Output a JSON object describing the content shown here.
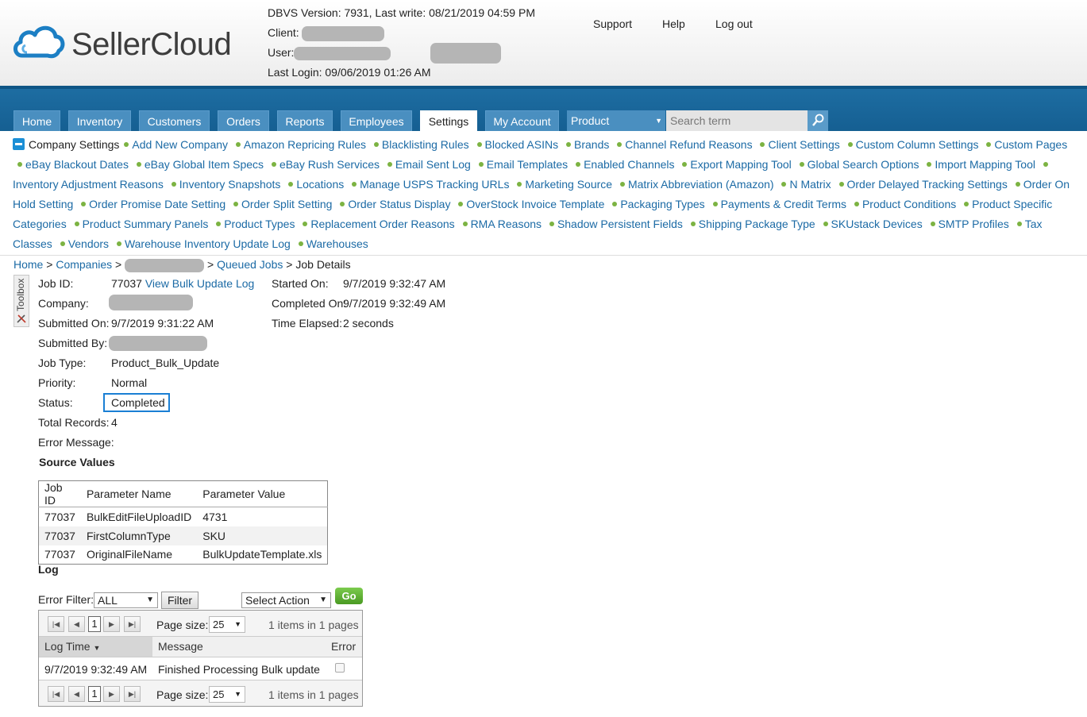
{
  "header": {
    "logo_text": "SellerCloud",
    "version_line": "DBVS Version: 7931, Last write: 08/21/2019 04:59 PM",
    "client_label": "Client:",
    "user_label": "User:",
    "last_login": "Last Login: 09/06/2019 01:26 AM",
    "links": {
      "support": "Support",
      "help": "Help",
      "logout": "Log out"
    }
  },
  "nav": {
    "tabs": [
      "Home",
      "Inventory",
      "Customers",
      "Orders",
      "Reports",
      "Employees",
      "Settings",
      "My Account"
    ],
    "active_tab": "Settings",
    "search_scope": "Product",
    "search_placeholder": "Search term"
  },
  "settings_menu": {
    "title": "Company Settings",
    "items": [
      "Add New Company",
      "Amazon Repricing Rules",
      "Blacklisting Rules",
      "Blocked ASINs",
      "Brands",
      "Channel Refund Reasons",
      "Client Settings",
      "Custom Column Settings",
      "Custom Pages",
      "eBay Blackout Dates",
      "eBay Global Item Specs",
      "eBay Rush Services",
      "Email Sent Log",
      "Email Templates",
      "Enabled Channels",
      "Export Mapping Tool",
      "Global Search Options",
      "Import Mapping Tool",
      "Inventory Adjustment Reasons",
      "Inventory Snapshots",
      "Locations",
      "Manage USPS Tracking URLs",
      "Marketing Source",
      "Matrix Abbreviation (Amazon)",
      "N Matrix",
      "Order Delayed Tracking Settings",
      "Order On Hold Setting",
      "Order Promise Date Setting",
      "Order Split Setting",
      "Order Status Display",
      "OverStock Invoice Template",
      "Packaging Types",
      "Payments & Credit Terms",
      "Product Conditions",
      "Product Specific Categories",
      "Product Summary Panels",
      "Product Types",
      "Replacement Order Reasons",
      "RMA Reasons",
      "Shadow Persistent Fields",
      "Shipping Package Type",
      "SKUstack Devices",
      "SMTP Profiles",
      "Tax Classes",
      "Vendors",
      "Warehouse Inventory Update Log",
      "Warehouses"
    ]
  },
  "breadcrumb": {
    "home": "Home",
    "companies": "Companies",
    "queued_jobs": "Queued Jobs",
    "current": "Job Details",
    "sep": ">"
  },
  "toolbox_label": "Toolbox",
  "job": {
    "job_id_label": "Job ID:",
    "job_id": "77037",
    "view_log_link": "View Bulk Update Log",
    "company_label": "Company:",
    "submitted_on_label": "Submitted On:",
    "submitted_on": "9/7/2019 9:31:22 AM",
    "submitted_by_label": "Submitted By:",
    "job_type_label": "Job Type:",
    "job_type": "Product_Bulk_Update",
    "priority_label": "Priority:",
    "priority": "Normal",
    "status_label": "Status:",
    "status": "Completed",
    "total_records_label": "Total Records:",
    "total_records": "4",
    "error_message_label": "Error Message:",
    "started_on_label": "Started On:",
    "started_on": "9/7/2019 9:32:47 AM",
    "completed_on_label": "Completed On:",
    "completed_on": "9/7/2019 9:32:49 AM",
    "time_elapsed_label": "Time Elapsed:",
    "time_elapsed": "2 seconds"
  },
  "source_values": {
    "title": "Source Values",
    "columns": [
      "Job ID",
      "Parameter Name",
      "Parameter Value"
    ],
    "rows": [
      [
        "77037",
        "BulkEditFileUploadID",
        "4731"
      ],
      [
        "77037",
        "FirstColumnType",
        "SKU"
      ],
      [
        "77037",
        "OriginalFileName",
        "BulkUpdateTemplate.xls"
      ]
    ]
  },
  "log": {
    "title": "Log",
    "error_filter_label": "Error Filter:",
    "error_filter_value": "ALL",
    "filter_button": "Filter",
    "action_select": "Select Action",
    "go_button": "Go",
    "pager": {
      "page": "1",
      "page_size_label": "Page size:",
      "page_size": "25",
      "summary": "1 items in 1 pages"
    },
    "columns": [
      "Log Time",
      "Message",
      "Error"
    ],
    "rows": [
      {
        "time": "9/7/2019 9:32:49 AM",
        "message": "Finished Processing Bulk update",
        "error": false
      }
    ]
  }
}
